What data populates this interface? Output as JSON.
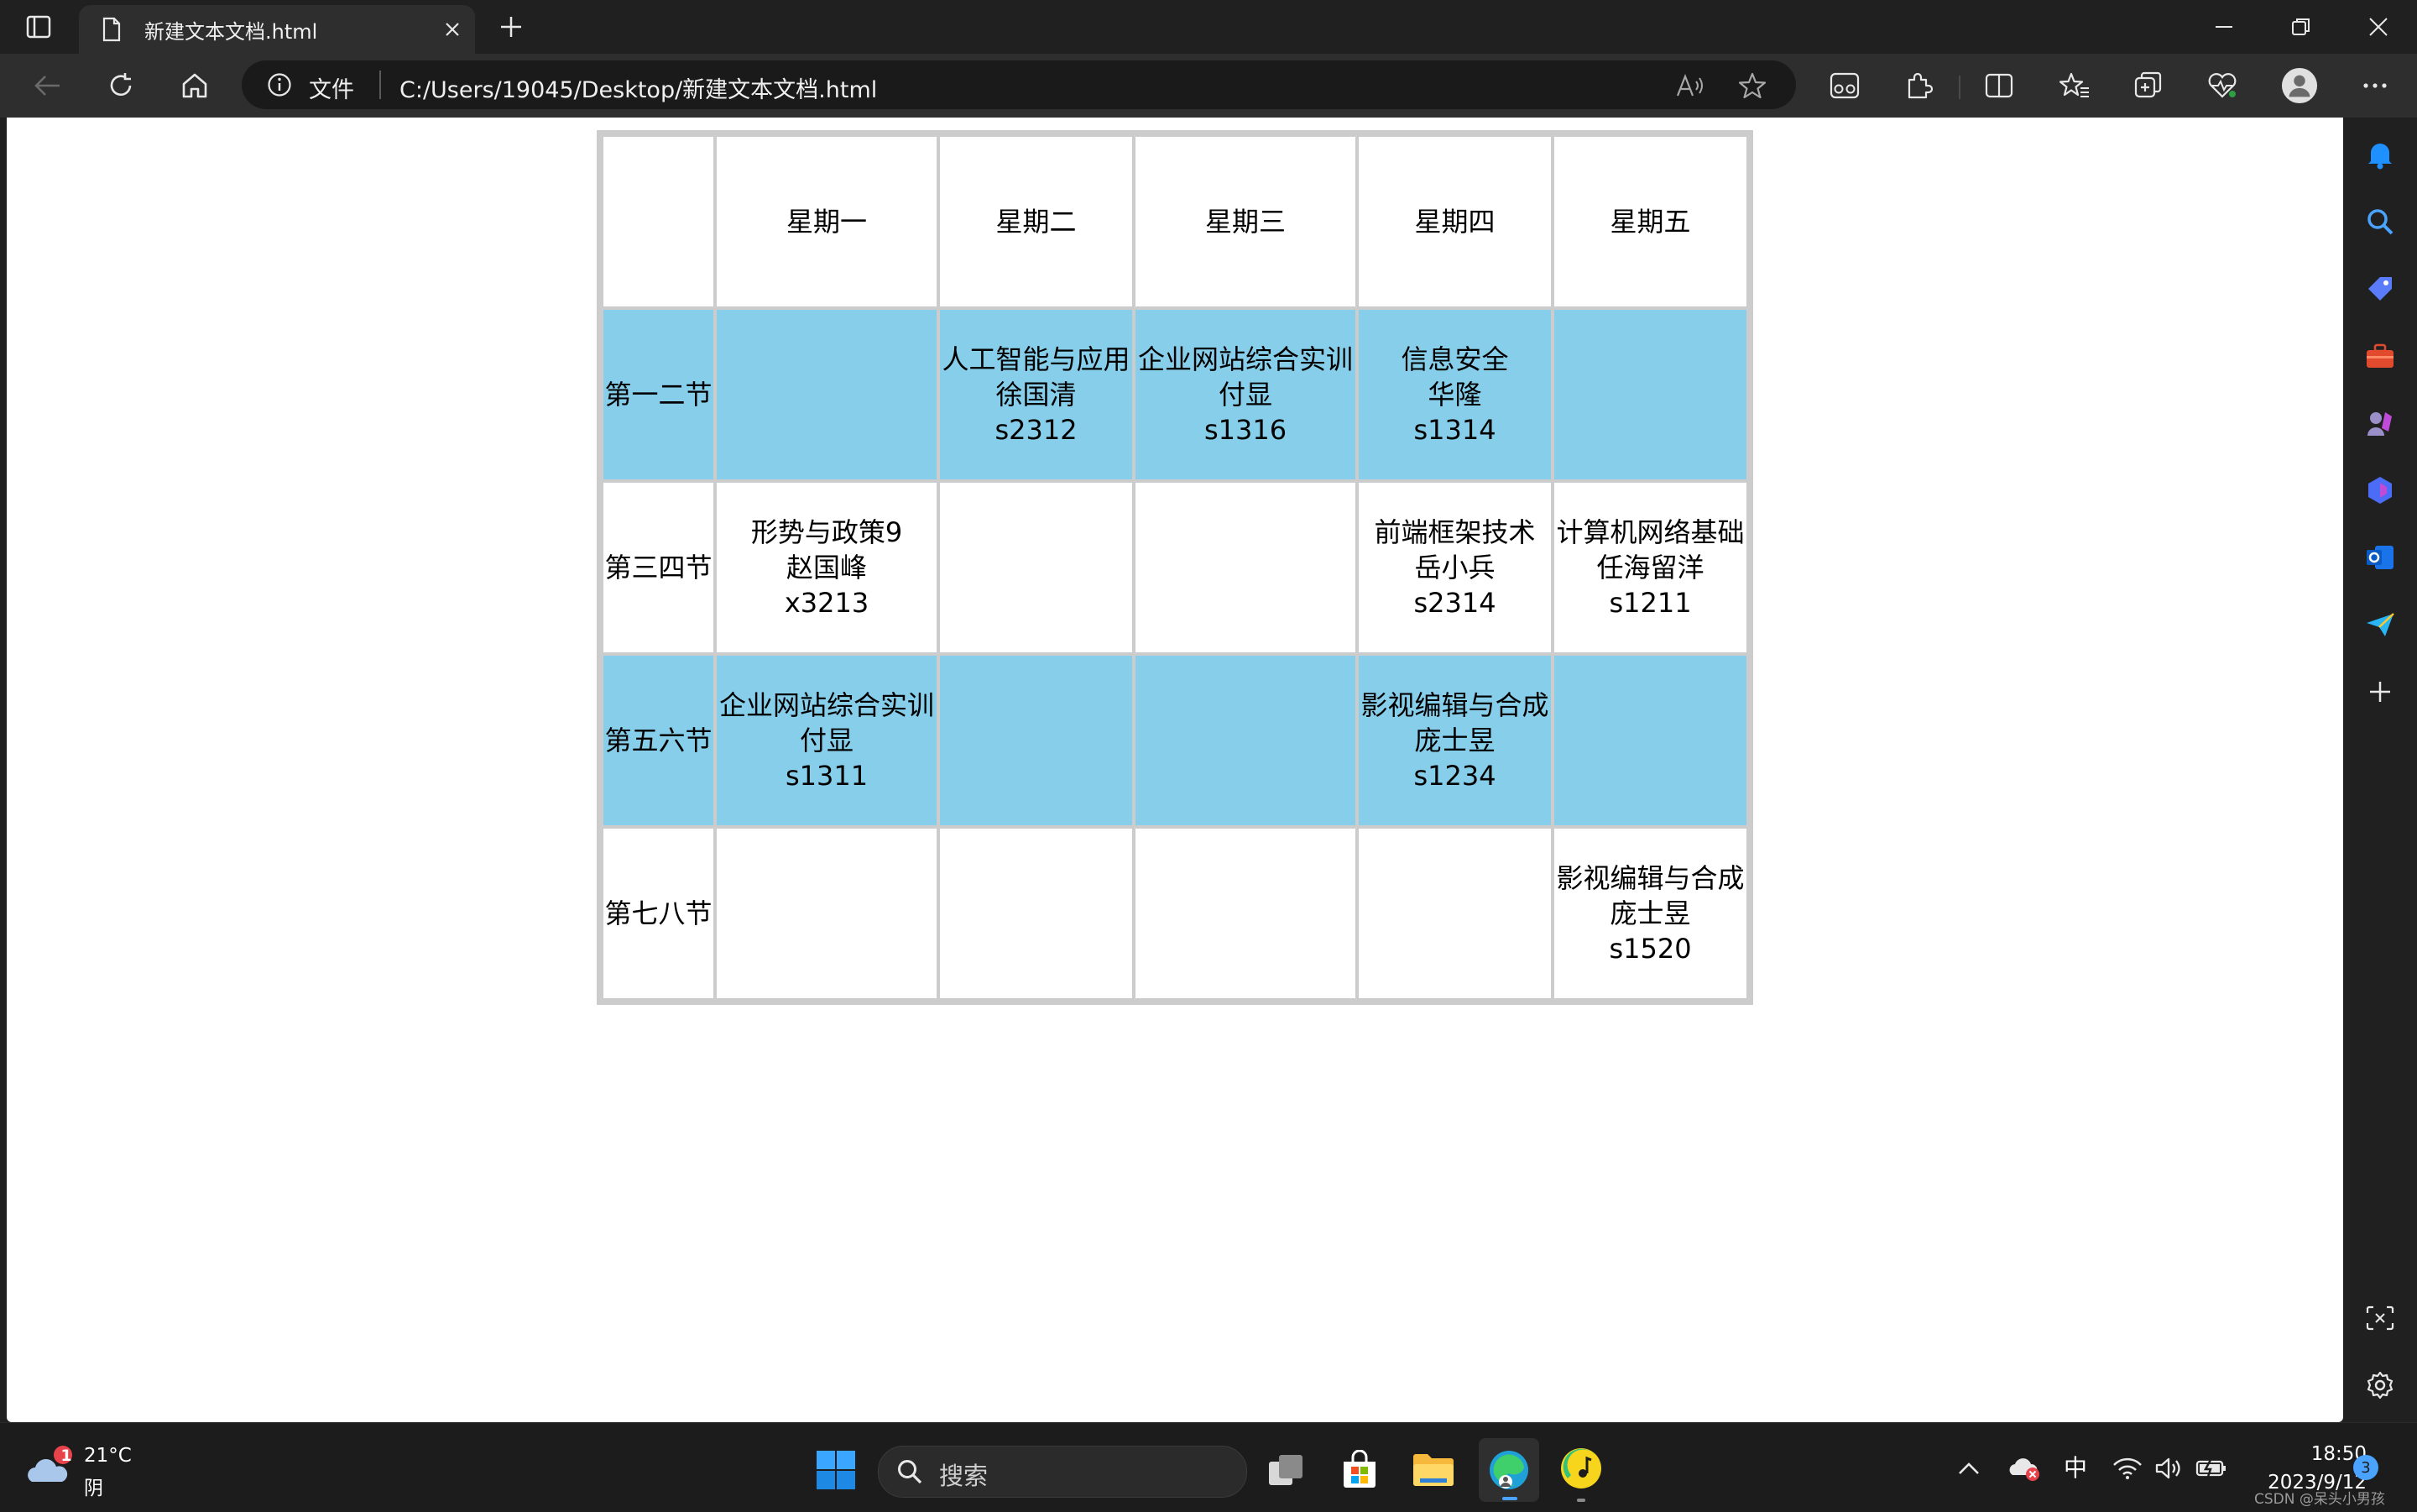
{
  "browser": {
    "tab_title": "新建文本文档.html",
    "address_protocol": "文件",
    "address_url": "C:/Users/19045/Desktop/新建文本文档.html"
  },
  "schedule": {
    "header": [
      "",
      "星期一",
      "星期二",
      "星期三",
      "星期四",
      "星期五"
    ],
    "rows": [
      {
        "label": "第一二节",
        "highlight": true,
        "cells": [
          [],
          [
            "人工智能与应用",
            "徐国清",
            "s2312"
          ],
          [
            "企业网站综合实训",
            "付显",
            "s1316"
          ],
          [
            "信息安全",
            "华隆",
            "s1314"
          ],
          []
        ]
      },
      {
        "label": "第三四节",
        "highlight": false,
        "cells": [
          [
            "形势与政策9",
            "赵国峰",
            "x3213"
          ],
          [],
          [],
          [
            "前端框架技术",
            "岳小兵",
            "s2314"
          ],
          [
            "计算机网络基础",
            "任海留洋",
            "s1211"
          ]
        ]
      },
      {
        "label": "第五六节",
        "highlight": true,
        "cells": [
          [
            "企业网站综合实训",
            "付显",
            "s1311"
          ],
          [],
          [],
          [
            "影视编辑与合成",
            "庞士昱",
            "s1234"
          ],
          []
        ]
      },
      {
        "label": "第七八节",
        "highlight": false,
        "cells": [
          [],
          [],
          [],
          [],
          [
            "影视编辑与合成",
            "庞士昱",
            "s1520"
          ]
        ]
      }
    ],
    "highlight_color": "#87ceeb"
  },
  "taskbar": {
    "weather_badge": "1",
    "weather_temp": "21°C",
    "weather_condition": "阴",
    "search_label": "搜索",
    "ime": "中",
    "time": "18:50",
    "date": "2023/9/12",
    "notification_count": "3",
    "watermark": "CSDN @呆头小男孩"
  }
}
